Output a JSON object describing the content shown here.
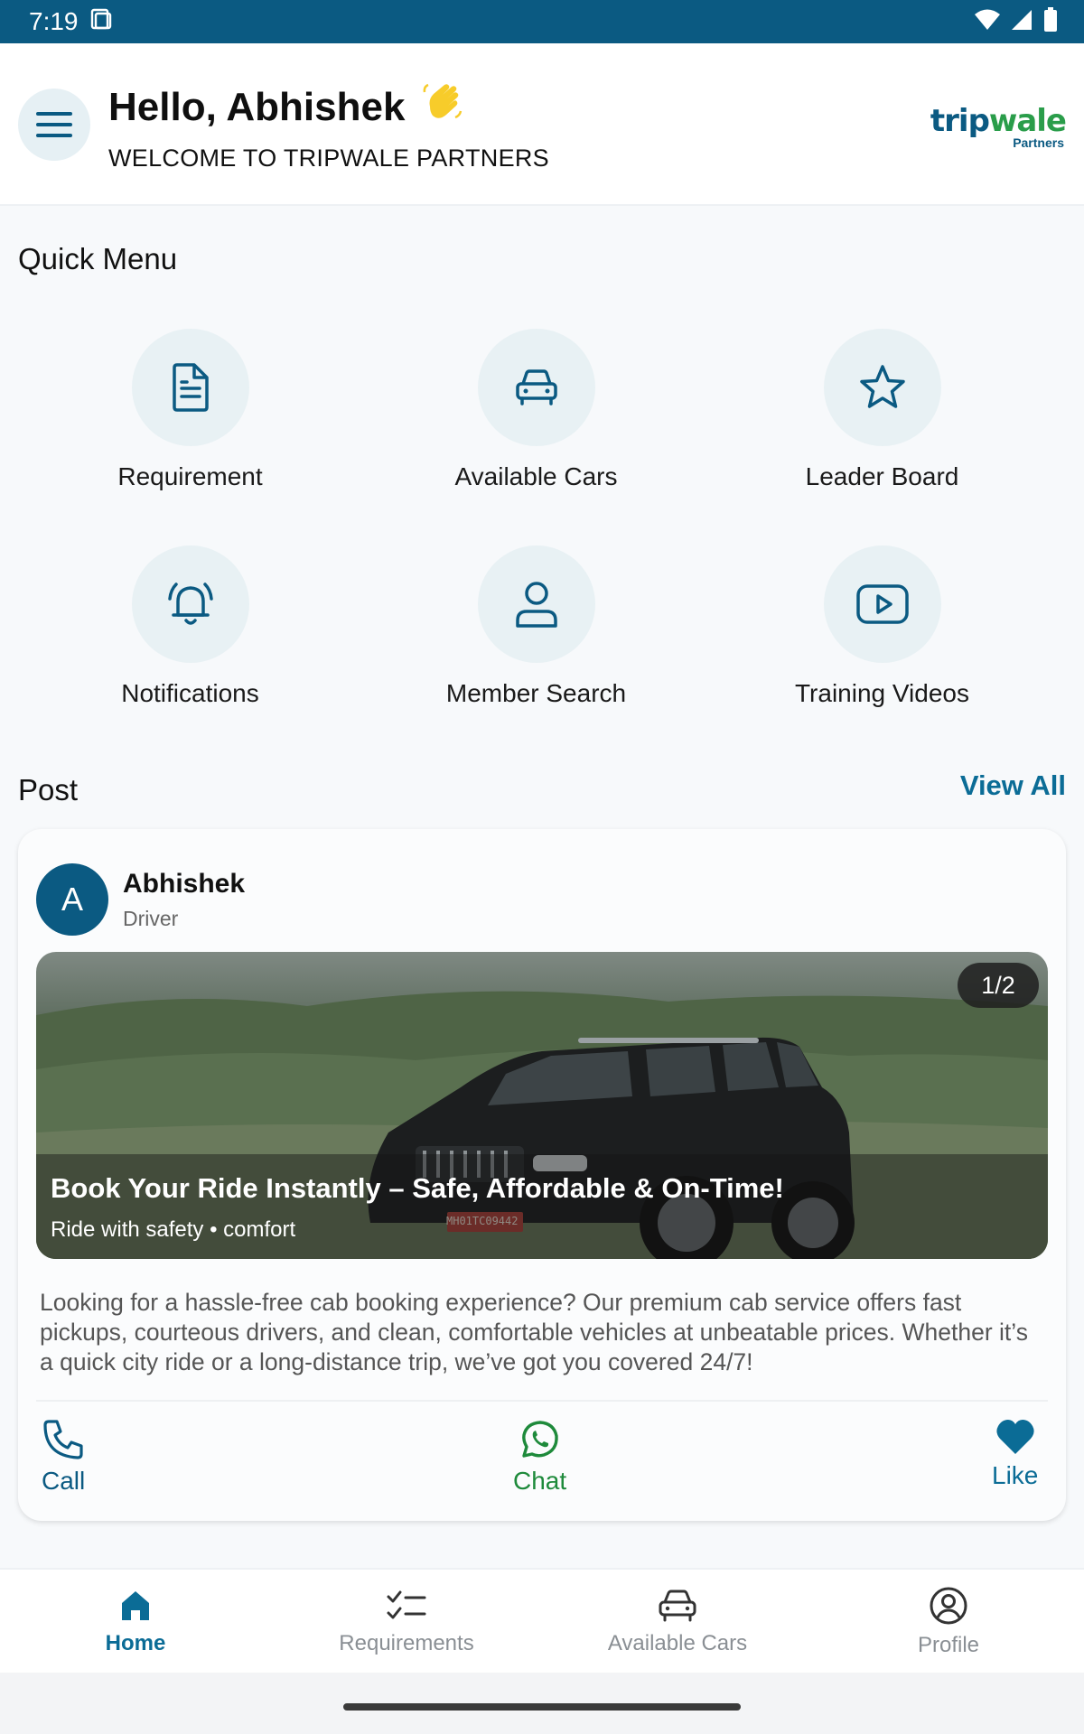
{
  "status_bar": {
    "time": "7:19"
  },
  "header": {
    "greeting": "Hello, Abhishek",
    "welcome": "WELCOME TO TRIPWALE PARTNERS",
    "brand_trip": "trip",
    "brand_wale": "wale",
    "brand_sub": "Partners"
  },
  "quick_menu": {
    "title": "Quick Menu",
    "items": [
      {
        "label": "Requirement",
        "icon": "document-icon"
      },
      {
        "label": "Available Cars",
        "icon": "car-icon"
      },
      {
        "label": "Leader Board",
        "icon": "star-icon"
      },
      {
        "label": "Notifications",
        "icon": "bell-icon"
      },
      {
        "label": "Member Search",
        "icon": "user-icon"
      },
      {
        "label": "Training Videos",
        "icon": "video-icon"
      }
    ]
  },
  "post_section": {
    "title": "Post",
    "view_all": "View All"
  },
  "post": {
    "avatar_initial": "A",
    "author": "Abhishek",
    "role": "Driver",
    "slide_counter": "1/2",
    "image_title": "Book Your Ride Instantly – Safe, Affordable & On-Time!",
    "image_subtitle": "Ride with safety • comfort",
    "plate": "MH01TC09442",
    "body": "Looking for a hassle-free cab booking experience? Our premium cab service offers fast pickups, courteous drivers, and clean, comfortable vehicles at unbeatable prices. Whether it’s a quick city ride or a long-distance trip, we’ve got you covered 24/7!",
    "actions": {
      "call": "Call",
      "chat": "Chat",
      "like": "Like"
    }
  },
  "bottom_nav": [
    {
      "label": "Home",
      "active": true
    },
    {
      "label": "Requirements",
      "active": false
    },
    {
      "label": "Available Cars",
      "active": false
    },
    {
      "label": "Profile",
      "active": false
    }
  ],
  "colors": {
    "primary": "#0b5a82",
    "accent": "#0b6c96",
    "brand_green": "#2a9d4a",
    "whatsapp": "#1e8a3b",
    "icon_bg": "#e8f1f4"
  }
}
